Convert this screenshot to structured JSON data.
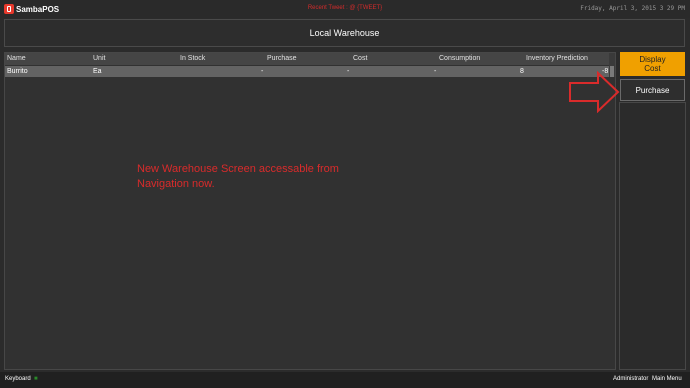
{
  "app": {
    "name": "SambaPOS",
    "ticker": "Recent Tweet : @ {TWEET}",
    "datetime": "Friday, April 3, 2015 3 29 PM"
  },
  "page": {
    "title": "Local Warehouse"
  },
  "grid": {
    "columns": [
      "Name",
      "Unit",
      "In Stock",
      "Purchase",
      "Cost",
      "Consumption",
      "Inventory Prediction"
    ],
    "rows": [
      {
        "name": "Burrito",
        "unit": "Ea",
        "in_stock": "",
        "purchase": "-",
        "cost": "-",
        "consumption": "-",
        "inventory_prediction": "8",
        "extra": "-8"
      }
    ]
  },
  "buttons": {
    "display_cost_line1": "Display",
    "display_cost_line2": "Cost",
    "purchase": "Purchase"
  },
  "annotation": {
    "line1": "New Warehouse Screen accessable from",
    "line2": "Navigation now."
  },
  "statusbar": {
    "keyboard": "Keyboard",
    "user": "Administrator",
    "main_menu": "Main Menu"
  },
  "colors": {
    "accent": "#f0a000",
    "annotation": "#d92b2b",
    "background": "#2b2b2b"
  }
}
